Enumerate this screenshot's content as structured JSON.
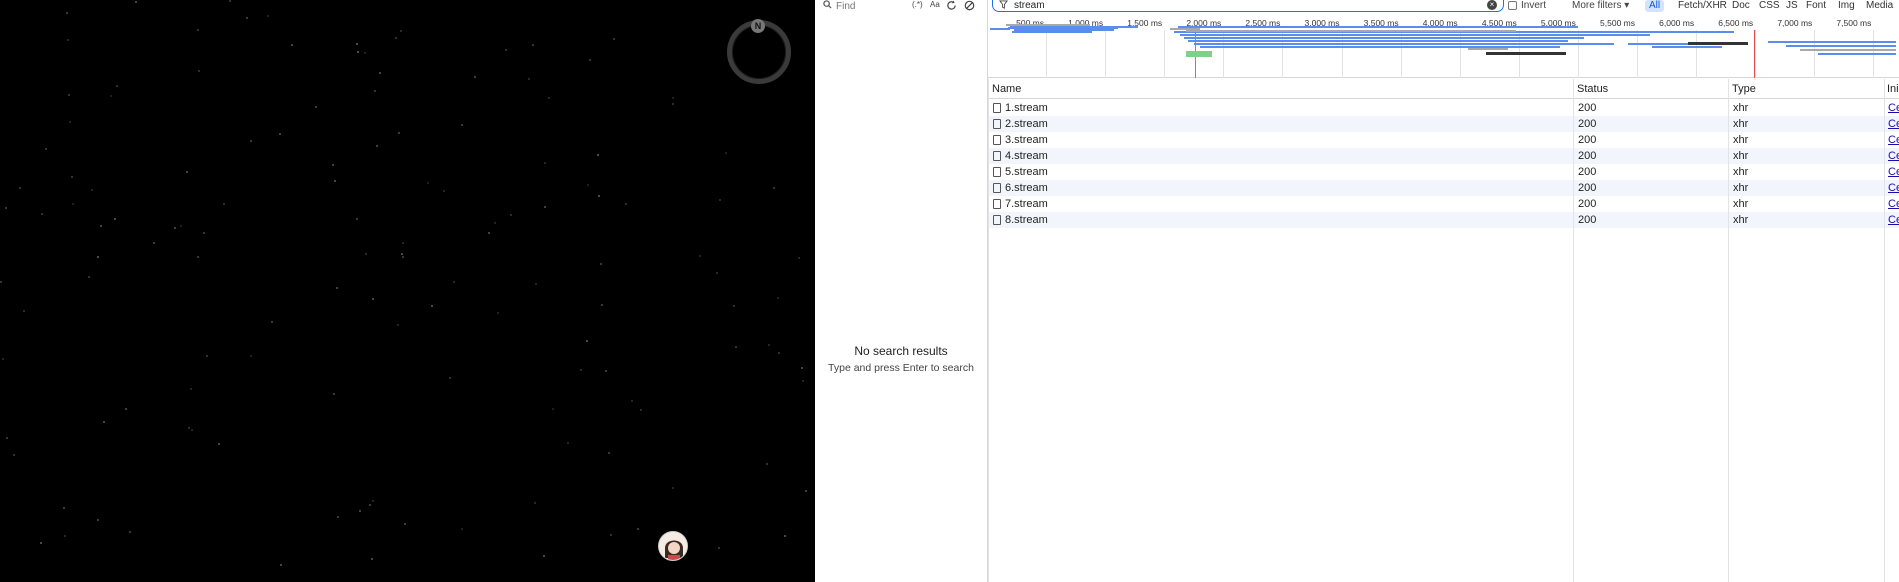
{
  "search": {
    "find_placeholder": "Find",
    "regex_label": "(.*)",
    "case_label": "Aa",
    "no_results": "No search results",
    "hint": "Type and press Enter to search"
  },
  "page_view": {
    "ring_badge": "N"
  },
  "network": {
    "filter_value": "stream",
    "invert_label": "Invert",
    "more_filters_label": "More filters",
    "type_filters": [
      "All",
      "Fetch/XHR",
      "Doc",
      "CSS",
      "JS",
      "Font",
      "Img",
      "Media"
    ],
    "active_type": "All",
    "timeline_ticks": [
      "500 ms",
      "1,000 ms",
      "1,500 ms",
      "2,000 ms",
      "2,500 ms",
      "3,000 ms",
      "3,500 ms",
      "4,000 ms",
      "4,500 ms",
      "5,000 ms",
      "5,500 ms",
      "6,000 ms",
      "6,500 ms",
      "7,000 ms",
      "7,500 ms"
    ],
    "columns": {
      "name": "Name",
      "status": "Status",
      "type": "Type",
      "initiator": "Ini"
    },
    "rows": [
      {
        "name": "1.stream",
        "status": "200",
        "type": "xhr",
        "initiator": "Ce"
      },
      {
        "name": "2.stream",
        "status": "200",
        "type": "xhr",
        "initiator": "Ce"
      },
      {
        "name": "3.stream",
        "status": "200",
        "type": "xhr",
        "initiator": "Ce"
      },
      {
        "name": "4.stream",
        "status": "200",
        "type": "xhr",
        "initiator": "Ce"
      },
      {
        "name": "5.stream",
        "status": "200",
        "type": "xhr",
        "initiator": "Ce"
      },
      {
        "name": "6.stream",
        "status": "200",
        "type": "xhr",
        "initiator": "Ce"
      },
      {
        "name": "7.stream",
        "status": "200",
        "type": "xhr",
        "initiator": "Ce"
      },
      {
        "name": "8.stream",
        "status": "200",
        "type": "xhr",
        "initiator": "Ce"
      }
    ]
  },
  "colors": {
    "accent": "#1a73e8",
    "chip_active_bg": "#d3e3fd",
    "waterfall_blue": "#5b8def",
    "waterfall_red_marker": "#e34d4d"
  }
}
